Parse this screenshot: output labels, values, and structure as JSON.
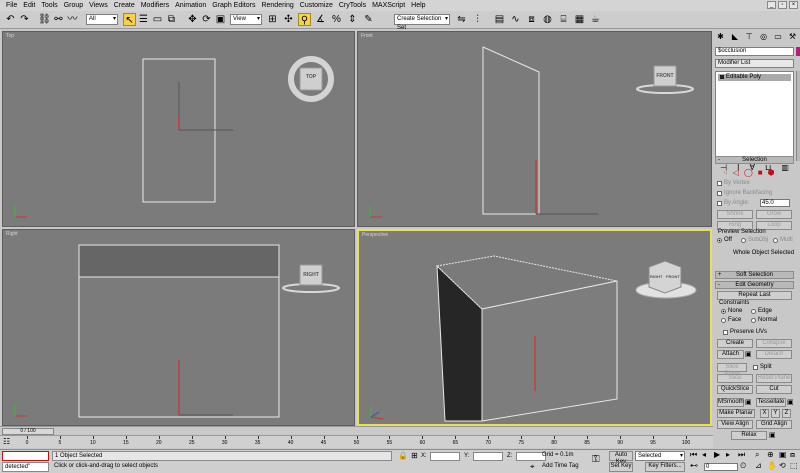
{
  "menu": [
    "File",
    "Edit",
    "Tools",
    "Group",
    "Views",
    "Create",
    "Modifiers",
    "Animation",
    "Graph Editors",
    "Rendering",
    "Customize",
    "CryTools",
    "MAXScript",
    "Help"
  ],
  "toolbar": {
    "filter_value": "All",
    "coord_value": "View",
    "selection_set_placeholder": "Create Selection Set"
  },
  "viewports": {
    "top": {
      "label": "Top",
      "cube_label": "TOP"
    },
    "front": {
      "label": "Front",
      "cube_label": "FRONT"
    },
    "right": {
      "label": "Right",
      "cube_label": "RIGHT"
    },
    "perspective": {
      "label": "Perspective",
      "cube_front": "RIGHT",
      "cube_side": "FRONT"
    }
  },
  "command_panel": {
    "object_name": "$occlusion",
    "modifier_list_label": "Modifier List",
    "stack_items": [
      "Editable Poly"
    ],
    "selection": {
      "title": "Selection",
      "by_vertex": "By Vertex",
      "ignore_backfacing": "Ignore Backfacing",
      "by_angle": "By Angle:",
      "angle_value": "45.0",
      "shrink": "Shrink",
      "grow": "Grow",
      "ring": "Ring",
      "loop": "Loop",
      "preview_title": "Preview Selection",
      "preview_off": "Off",
      "preview_subobj": "SubObj",
      "preview_multi": "Multi",
      "status": "Whole Object Selected"
    },
    "soft_selection": "Soft Selection",
    "edit_geometry": {
      "title": "Edit Geometry",
      "repeat_last": "Repeat Last",
      "constraints_title": "Constraints",
      "none": "None",
      "edge": "Edge",
      "face": "Face",
      "normal": "Normal",
      "preserve_uvs": "Preserve UVs",
      "create": "Create",
      "collapse": "Collapse",
      "attach": "Attach",
      "detach": "Detach",
      "slice_plane": "Slice Plane",
      "split": "Split",
      "slice": "Slice",
      "reset_plane": "Reset Plane",
      "quickslice": "QuickSlice",
      "cut": "Cut",
      "msmooth": "MSmooth",
      "tessellate": "Tessellate",
      "make_planar": "Make Planar",
      "x": "X",
      "y": "Y",
      "z": "Z",
      "view_align": "View Align",
      "grid_align": "Grid Align",
      "relax": "Relax"
    }
  },
  "timeline": {
    "frame_display": "0 / 100",
    "ticks": [
      "0",
      "5",
      "10",
      "15",
      "20",
      "25",
      "30",
      "35",
      "40",
      "45",
      "50",
      "55",
      "60",
      "65",
      "70",
      "75",
      "80",
      "85",
      "90",
      "95",
      "100"
    ]
  },
  "status": {
    "script_listener": "detected\"",
    "selection_count": "1 Object Selected",
    "prompt": "Click or click-and-drag to select objects",
    "x_label": "X:",
    "y_label": "Y:",
    "z_label": "Z:",
    "grid": "Grid = 0.1m",
    "add_time_tag": "Add Time Tag",
    "auto_key": "Auto Key",
    "set_key": "Set Key",
    "key_mode_value": "Selected",
    "key_filters": "Key Filters...",
    "frame_value": "0"
  }
}
